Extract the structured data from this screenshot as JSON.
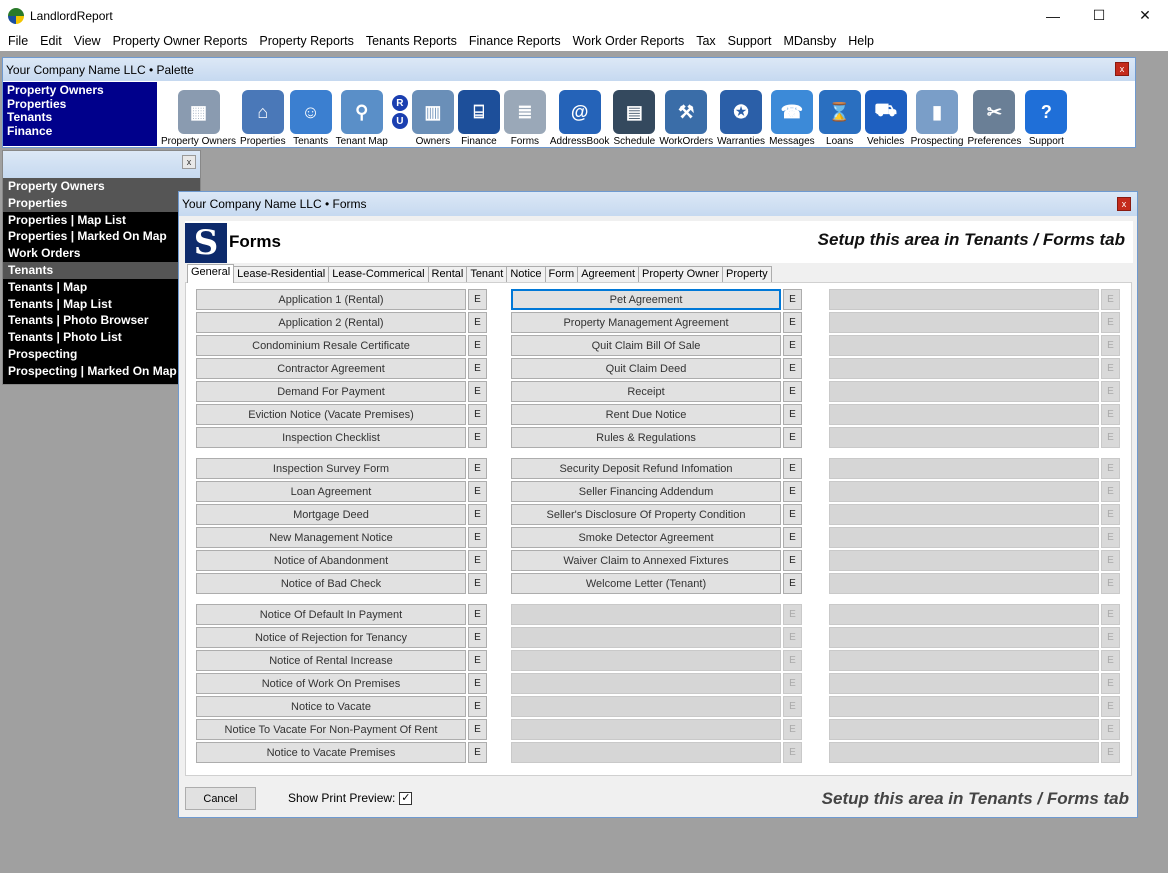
{
  "app": {
    "title": "LandlordReport"
  },
  "window_controls": {
    "minimize": "—",
    "maximize": "☐",
    "close": "✕"
  },
  "menu": [
    "File",
    "Edit",
    "View",
    "Property Owner Reports",
    "Property Reports",
    "Tenants Reports",
    "Finance Reports",
    "Work Order Reports",
    "Tax",
    "Support",
    "MDansby",
    "Help"
  ],
  "palette": {
    "title": "Your Company Name LLC  • Palette",
    "close": "x",
    "links": [
      "Property Owners",
      "Properties",
      "Tenants",
      "Finance"
    ],
    "ru": [
      "R",
      "U"
    ],
    "icons": [
      {
        "label": "Property Owners",
        "icon": "building-icon",
        "glyph": "▦",
        "color": "#8a9bb0"
      },
      {
        "label": "Properties",
        "icon": "house-icon",
        "glyph": "⌂",
        "color": "#4a78b8"
      },
      {
        "label": "Tenants",
        "icon": "people-icon",
        "glyph": "☺",
        "color": "#3b7fd0"
      },
      {
        "label": "Tenant Map",
        "icon": "magnifier-icon",
        "glyph": "⚲",
        "color": "#5a8fc8"
      },
      {
        "label": "Owners",
        "icon": "office-building-icon",
        "glyph": "▥",
        "color": "#6a8fb8"
      },
      {
        "label": "Finance",
        "icon": "bank-icon",
        "glyph": "⌸",
        "color": "#1d4f9a"
      },
      {
        "label": "Forms",
        "icon": "forms-icon",
        "glyph": "≣",
        "color": "#9aa8b8"
      },
      {
        "label": "AddressBook",
        "icon": "address-book-icon",
        "glyph": "@",
        "color": "#2563b8"
      },
      {
        "label": "Schedule",
        "icon": "calendar-icon",
        "glyph": "▤",
        "color": "#34495e"
      },
      {
        "label": "WorkOrders",
        "icon": "tools-icon",
        "glyph": "⚒",
        "color": "#3a6da8"
      },
      {
        "label": "Warranties",
        "icon": "badge-icon",
        "glyph": "✪",
        "color": "#2b5fa8"
      },
      {
        "label": "Messages",
        "icon": "telephone-icon",
        "glyph": "☎",
        "color": "#3c8ad8"
      },
      {
        "label": "Loans",
        "icon": "hourglass-icon",
        "glyph": "⌛",
        "color": "#2a6fc0"
      },
      {
        "label": "Vehicles",
        "icon": "car-icon",
        "glyph": "⛟",
        "color": "#1e5fc0"
      },
      {
        "label": "Prospecting",
        "icon": "skyscraper-icon",
        "glyph": "▮",
        "color": "#7a9ec8"
      },
      {
        "label": "Preferences",
        "icon": "wrench-icon",
        "glyph": "✂",
        "color": "#6a7f96"
      },
      {
        "label": "Support",
        "icon": "help-icon",
        "glyph": "?",
        "color": "#1f6fd8"
      }
    ]
  },
  "left_nav": {
    "close": "x",
    "items": [
      {
        "label": "Property Owners",
        "header": true
      },
      {
        "label": "Properties",
        "header": true
      },
      {
        "label": "Properties | Map List",
        "header": false
      },
      {
        "label": "Properties | Marked On Map",
        "header": false
      },
      {
        "label": "Work Orders",
        "header": false
      },
      {
        "label": "Tenants",
        "header": true
      },
      {
        "label": "Tenants | Map",
        "header": false
      },
      {
        "label": "Tenants | Map List",
        "header": false
      },
      {
        "label": "Tenants | Photo Browser",
        "header": false
      },
      {
        "label": "Tenants | Photo List",
        "header": false
      },
      {
        "label": "Prospecting",
        "header": false
      },
      {
        "label": "Prospecting | Marked On Map",
        "header": false
      }
    ]
  },
  "forms_window": {
    "title": "Your Company Name LLC  •  Forms",
    "close": "x",
    "logo_letter": "S",
    "heading": "Forms",
    "setup_text": "Setup this area in Tenants / Forms tab",
    "tabs": [
      "General",
      "Lease-Residential",
      "Lease-Commerical",
      "Rental",
      "Tenant",
      "Notice",
      "Form",
      "Agreement",
      "Property Owner",
      "Property"
    ],
    "active_tab": "General",
    "edit_label": "E",
    "columns": [
      [
        [
          "Application 1 (Rental)",
          "Application 2 (Rental)",
          "Condominium Resale Certificate",
          "Contractor Agreement",
          "Demand For Payment",
          "Eviction Notice (Vacate Premises)",
          "Inspection Checklist"
        ],
        [
          "Inspection Survey Form",
          "Loan Agreement",
          "Mortgage Deed",
          "New Management Notice",
          "Notice of Abandonment",
          "Notice of Bad Check"
        ],
        [
          "Notice Of Default In Payment",
          "Notice of Rejection for Tenancy",
          "Notice of Rental Increase",
          "Notice of Work On Premises",
          "Notice to Vacate",
          "Notice To Vacate For Non-Payment Of Rent",
          "Notice to Vacate Premises"
        ]
      ],
      [
        [
          "Pet Agreement",
          "Property Management Agreement",
          "Quit Claim Bill Of Sale",
          "Quit Claim Deed",
          "Receipt",
          "Rent Due Notice",
          "Rules & Regulations"
        ],
        [
          "Security Deposit Refund Infomation",
          "Seller Financing Addendum",
          "Seller's Disclosure Of Property Condition",
          "Smoke Detector Agreement",
          "Waiver Claim to Annexed Fixtures",
          "Welcome Letter (Tenant)"
        ],
        [
          "",
          "",
          "",
          "",
          "",
          "",
          ""
        ]
      ],
      [
        [
          "",
          "",
          "",
          "",
          "",
          "",
          ""
        ],
        [
          "",
          "",
          "",
          "",
          "",
          ""
        ],
        [
          "",
          "",
          "",
          "",
          "",
          "",
          ""
        ]
      ]
    ],
    "selected_form": "Pet Agreement",
    "cancel_label": "Cancel",
    "print_preview_label": "Show Print Preview:",
    "print_preview_checked": true,
    "footer_setup_text": "Setup this area in Tenants / Forms tab"
  }
}
